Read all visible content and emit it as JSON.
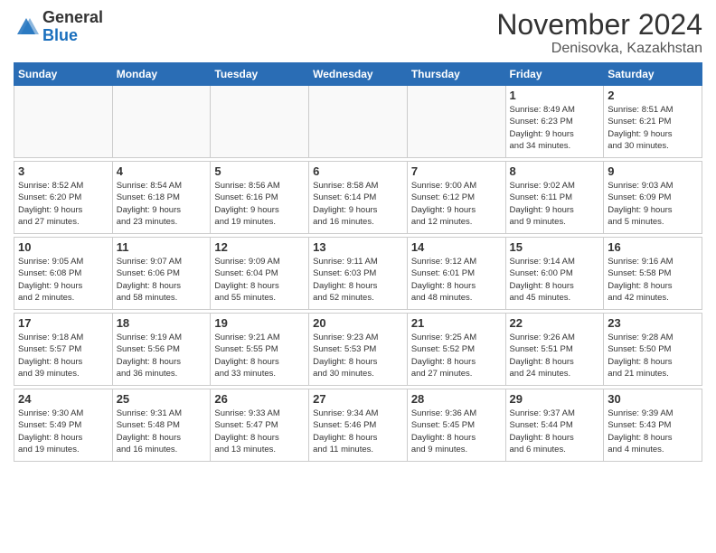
{
  "header": {
    "logo_general": "General",
    "logo_blue": "Blue",
    "month_title": "November 2024",
    "location": "Denisovka, Kazakhstan"
  },
  "weekdays": [
    "Sunday",
    "Monday",
    "Tuesday",
    "Wednesday",
    "Thursday",
    "Friday",
    "Saturday"
  ],
  "weeks": [
    [
      {
        "day": "",
        "info": ""
      },
      {
        "day": "",
        "info": ""
      },
      {
        "day": "",
        "info": ""
      },
      {
        "day": "",
        "info": ""
      },
      {
        "day": "",
        "info": ""
      },
      {
        "day": "1",
        "info": "Sunrise: 8:49 AM\nSunset: 6:23 PM\nDaylight: 9 hours\nand 34 minutes."
      },
      {
        "day": "2",
        "info": "Sunrise: 8:51 AM\nSunset: 6:21 PM\nDaylight: 9 hours\nand 30 minutes."
      }
    ],
    [
      {
        "day": "3",
        "info": "Sunrise: 8:52 AM\nSunset: 6:20 PM\nDaylight: 9 hours\nand 27 minutes."
      },
      {
        "day": "4",
        "info": "Sunrise: 8:54 AM\nSunset: 6:18 PM\nDaylight: 9 hours\nand 23 minutes."
      },
      {
        "day": "5",
        "info": "Sunrise: 8:56 AM\nSunset: 6:16 PM\nDaylight: 9 hours\nand 19 minutes."
      },
      {
        "day": "6",
        "info": "Sunrise: 8:58 AM\nSunset: 6:14 PM\nDaylight: 9 hours\nand 16 minutes."
      },
      {
        "day": "7",
        "info": "Sunrise: 9:00 AM\nSunset: 6:12 PM\nDaylight: 9 hours\nand 12 minutes."
      },
      {
        "day": "8",
        "info": "Sunrise: 9:02 AM\nSunset: 6:11 PM\nDaylight: 9 hours\nand 9 minutes."
      },
      {
        "day": "9",
        "info": "Sunrise: 9:03 AM\nSunset: 6:09 PM\nDaylight: 9 hours\nand 5 minutes."
      }
    ],
    [
      {
        "day": "10",
        "info": "Sunrise: 9:05 AM\nSunset: 6:08 PM\nDaylight: 9 hours\nand 2 minutes."
      },
      {
        "day": "11",
        "info": "Sunrise: 9:07 AM\nSunset: 6:06 PM\nDaylight: 8 hours\nand 58 minutes."
      },
      {
        "day": "12",
        "info": "Sunrise: 9:09 AM\nSunset: 6:04 PM\nDaylight: 8 hours\nand 55 minutes."
      },
      {
        "day": "13",
        "info": "Sunrise: 9:11 AM\nSunset: 6:03 PM\nDaylight: 8 hours\nand 52 minutes."
      },
      {
        "day": "14",
        "info": "Sunrise: 9:12 AM\nSunset: 6:01 PM\nDaylight: 8 hours\nand 48 minutes."
      },
      {
        "day": "15",
        "info": "Sunrise: 9:14 AM\nSunset: 6:00 PM\nDaylight: 8 hours\nand 45 minutes."
      },
      {
        "day": "16",
        "info": "Sunrise: 9:16 AM\nSunset: 5:58 PM\nDaylight: 8 hours\nand 42 minutes."
      }
    ],
    [
      {
        "day": "17",
        "info": "Sunrise: 9:18 AM\nSunset: 5:57 PM\nDaylight: 8 hours\nand 39 minutes."
      },
      {
        "day": "18",
        "info": "Sunrise: 9:19 AM\nSunset: 5:56 PM\nDaylight: 8 hours\nand 36 minutes."
      },
      {
        "day": "19",
        "info": "Sunrise: 9:21 AM\nSunset: 5:55 PM\nDaylight: 8 hours\nand 33 minutes."
      },
      {
        "day": "20",
        "info": "Sunrise: 9:23 AM\nSunset: 5:53 PM\nDaylight: 8 hours\nand 30 minutes."
      },
      {
        "day": "21",
        "info": "Sunrise: 9:25 AM\nSunset: 5:52 PM\nDaylight: 8 hours\nand 27 minutes."
      },
      {
        "day": "22",
        "info": "Sunrise: 9:26 AM\nSunset: 5:51 PM\nDaylight: 8 hours\nand 24 minutes."
      },
      {
        "day": "23",
        "info": "Sunrise: 9:28 AM\nSunset: 5:50 PM\nDaylight: 8 hours\nand 21 minutes."
      }
    ],
    [
      {
        "day": "24",
        "info": "Sunrise: 9:30 AM\nSunset: 5:49 PM\nDaylight: 8 hours\nand 19 minutes."
      },
      {
        "day": "25",
        "info": "Sunrise: 9:31 AM\nSunset: 5:48 PM\nDaylight: 8 hours\nand 16 minutes."
      },
      {
        "day": "26",
        "info": "Sunrise: 9:33 AM\nSunset: 5:47 PM\nDaylight: 8 hours\nand 13 minutes."
      },
      {
        "day": "27",
        "info": "Sunrise: 9:34 AM\nSunset: 5:46 PM\nDaylight: 8 hours\nand 11 minutes."
      },
      {
        "day": "28",
        "info": "Sunrise: 9:36 AM\nSunset: 5:45 PM\nDaylight: 8 hours\nand 9 minutes."
      },
      {
        "day": "29",
        "info": "Sunrise: 9:37 AM\nSunset: 5:44 PM\nDaylight: 8 hours\nand 6 minutes."
      },
      {
        "day": "30",
        "info": "Sunrise: 9:39 AM\nSunset: 5:43 PM\nDaylight: 8 hours\nand 4 minutes."
      }
    ]
  ]
}
